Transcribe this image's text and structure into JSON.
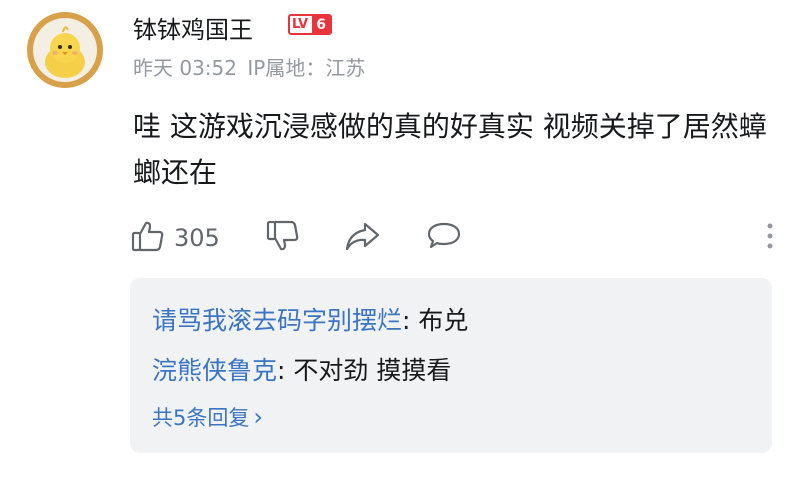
{
  "user": {
    "name": "钵钵鸡国王",
    "level_prefix": "LV",
    "level": "6",
    "time": "昨天 03:52",
    "ip_label": "IP属地：",
    "ip_location": "江苏"
  },
  "comment": {
    "text": "哇 这游戏沉浸感做的真的好真实 视频关掉了居然蟑螂还在"
  },
  "actions": {
    "like_count": "305"
  },
  "replies": {
    "items": [
      {
        "author": "请骂我滚去码字别摆烂",
        "separator": ": ",
        "text": "布兑"
      },
      {
        "author": "浣熊侠鲁克",
        "separator": ": ",
        "text": "不对劲 摸摸看"
      }
    ],
    "view_more": "共5条回复",
    "view_more_chevron": "›"
  },
  "colors": {
    "accent_link": "#3a75c4",
    "level_red": "#e8343d",
    "muted_text": "#9499a0"
  }
}
